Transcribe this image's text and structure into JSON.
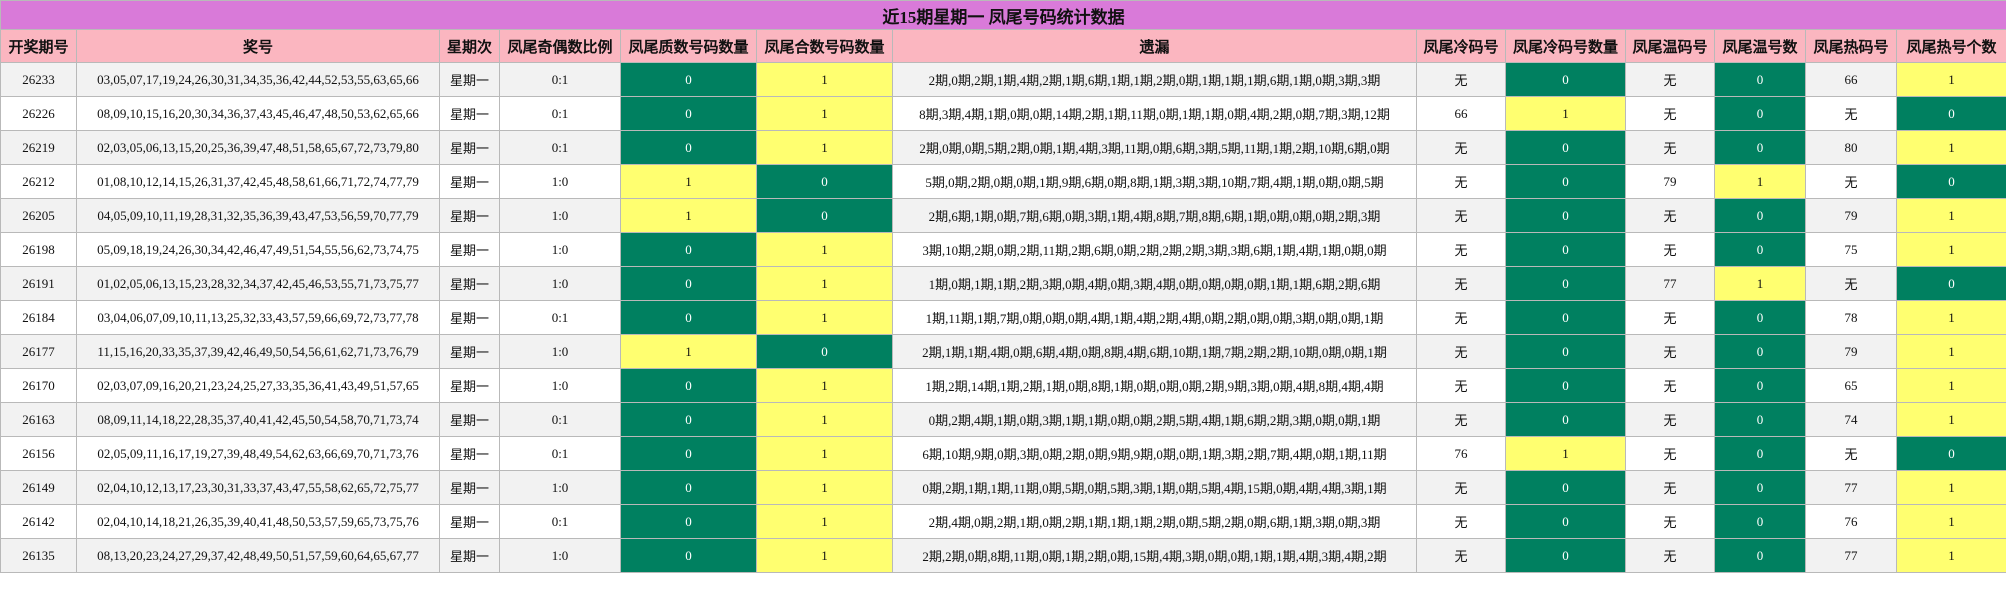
{
  "title": "近15期星期一 凤尾号码统计数据",
  "columns": [
    "开奖期号",
    "奖号",
    "星期次",
    "凤尾奇偶数比例",
    "凤尾质数号码数量",
    "凤尾合数号码数量",
    "遗漏",
    "凤尾冷码号",
    "凤尾冷码号数量",
    "凤尾温码号",
    "凤尾温号数",
    "凤尾热码号",
    "凤尾热号个数"
  ],
  "colors": {
    "green": "#008060",
    "yellow": "#ffff70",
    "title_bg": "#d97ad9",
    "header_bg": "#fbb6c0"
  },
  "rows": [
    [
      "26233",
      "03,05,07,17,19,24,26,30,31,34,35,36,42,44,52,53,55,63,65,66",
      "星期一",
      "0:1",
      "0",
      "1",
      "2期,0期,2期,1期,4期,2期,1期,6期,1期,1期,2期,0期,1期,1期,1期,6期,1期,0期,3期,3期",
      "无",
      "0",
      "无",
      "0",
      "66",
      "1"
    ],
    [
      "26226",
      "08,09,10,15,16,20,30,34,36,37,43,45,46,47,48,50,53,62,65,66",
      "星期一",
      "0:1",
      "0",
      "1",
      "8期,3期,4期,1期,0期,0期,14期,2期,1期,11期,0期,1期,1期,0期,4期,2期,0期,7期,3期,12期",
      "66",
      "1",
      "无",
      "0",
      "无",
      "0"
    ],
    [
      "26219",
      "02,03,05,06,13,15,20,25,36,39,47,48,51,58,65,67,72,73,79,80",
      "星期一",
      "0:1",
      "0",
      "1",
      "2期,0期,0期,5期,2期,0期,1期,4期,3期,11期,0期,6期,3期,5期,11期,1期,2期,10期,6期,0期",
      "无",
      "0",
      "无",
      "0",
      "80",
      "1"
    ],
    [
      "26212",
      "01,08,10,12,14,15,26,31,37,42,45,48,58,61,66,71,72,74,77,79",
      "星期一",
      "1:0",
      "1",
      "0",
      "5期,0期,2期,0期,0期,1期,9期,6期,0期,8期,1期,3期,3期,10期,7期,4期,1期,0期,0期,5期",
      "无",
      "0",
      "79",
      "1",
      "无",
      "0"
    ],
    [
      "26205",
      "04,05,09,10,11,19,28,31,32,35,36,39,43,47,53,56,59,70,77,79",
      "星期一",
      "1:0",
      "1",
      "0",
      "2期,6期,1期,0期,7期,6期,0期,3期,1期,4期,8期,7期,8期,6期,1期,0期,0期,0期,2期,3期",
      "无",
      "0",
      "无",
      "0",
      "79",
      "1"
    ],
    [
      "26198",
      "05,09,18,19,24,26,30,34,42,46,47,49,51,54,55,56,62,73,74,75",
      "星期一",
      "1:0",
      "0",
      "1",
      "3期,10期,2期,0期,2期,11期,2期,6期,0期,2期,2期,2期,3期,3期,6期,1期,4期,1期,0期,0期",
      "无",
      "0",
      "无",
      "0",
      "75",
      "1"
    ],
    [
      "26191",
      "01,02,05,06,13,15,23,28,32,34,37,42,45,46,53,55,71,73,75,77",
      "星期一",
      "1:0",
      "0",
      "1",
      "1期,0期,1期,1期,2期,3期,0期,4期,0期,3期,4期,0期,0期,0期,0期,1期,1期,6期,2期,6期",
      "无",
      "0",
      "77",
      "1",
      "无",
      "0"
    ],
    [
      "26184",
      "03,04,06,07,09,10,11,13,25,32,33,43,57,59,66,69,72,73,77,78",
      "星期一",
      "0:1",
      "0",
      "1",
      "1期,11期,1期,7期,0期,0期,0期,4期,1期,4期,2期,4期,0期,2期,0期,0期,3期,0期,0期,1期",
      "无",
      "0",
      "无",
      "0",
      "78",
      "1"
    ],
    [
      "26177",
      "11,15,16,20,33,35,37,39,42,46,49,50,54,56,61,62,71,73,76,79",
      "星期一",
      "1:0",
      "1",
      "0",
      "2期,1期,1期,4期,0期,6期,4期,0期,8期,4期,6期,10期,1期,7期,2期,2期,10期,0期,0期,1期",
      "无",
      "0",
      "无",
      "0",
      "79",
      "1"
    ],
    [
      "26170",
      "02,03,07,09,16,20,21,23,24,25,27,33,35,36,41,43,49,51,57,65",
      "星期一",
      "1:0",
      "0",
      "1",
      "1期,2期,14期,1期,2期,1期,0期,8期,1期,0期,0期,0期,2期,9期,3期,0期,4期,8期,4期,4期",
      "无",
      "0",
      "无",
      "0",
      "65",
      "1"
    ],
    [
      "26163",
      "08,09,11,14,18,22,28,35,37,40,41,42,45,50,54,58,70,71,73,74",
      "星期一",
      "0:1",
      "0",
      "1",
      "0期,2期,4期,1期,0期,3期,1期,1期,0期,0期,2期,5期,4期,1期,6期,2期,3期,0期,0期,1期",
      "无",
      "0",
      "无",
      "0",
      "74",
      "1"
    ],
    [
      "26156",
      "02,05,09,11,16,17,19,27,39,48,49,54,62,63,66,69,70,71,73,76",
      "星期一",
      "0:1",
      "0",
      "1",
      "6期,10期,9期,0期,3期,0期,2期,0期,9期,9期,0期,0期,1期,3期,2期,7期,4期,0期,1期,11期",
      "76",
      "1",
      "无",
      "0",
      "无",
      "0"
    ],
    [
      "26149",
      "02,04,10,12,13,17,23,30,31,33,37,43,47,55,58,62,65,72,75,77",
      "星期一",
      "1:0",
      "0",
      "1",
      "0期,2期,1期,1期,11期,0期,5期,0期,5期,3期,1期,0期,5期,4期,15期,0期,4期,4期,3期,1期",
      "无",
      "0",
      "无",
      "0",
      "77",
      "1"
    ],
    [
      "26142",
      "02,04,10,14,18,21,26,35,39,40,41,48,50,53,57,59,65,73,75,76",
      "星期一",
      "0:1",
      "0",
      "1",
      "2期,4期,0期,2期,1期,0期,2期,1期,1期,1期,2期,0期,5期,2期,0期,6期,1期,3期,0期,3期",
      "无",
      "0",
      "无",
      "0",
      "76",
      "1"
    ],
    [
      "26135",
      "08,13,20,23,24,27,29,37,42,48,49,50,51,57,59,60,64,65,67,77",
      "星期一",
      "1:0",
      "0",
      "1",
      "2期,2期,0期,8期,11期,0期,1期,2期,0期,15期,4期,3期,0期,0期,1期,1期,4期,3期,4期,2期",
      "无",
      "0",
      "无",
      "0",
      "77",
      "1"
    ]
  ]
}
